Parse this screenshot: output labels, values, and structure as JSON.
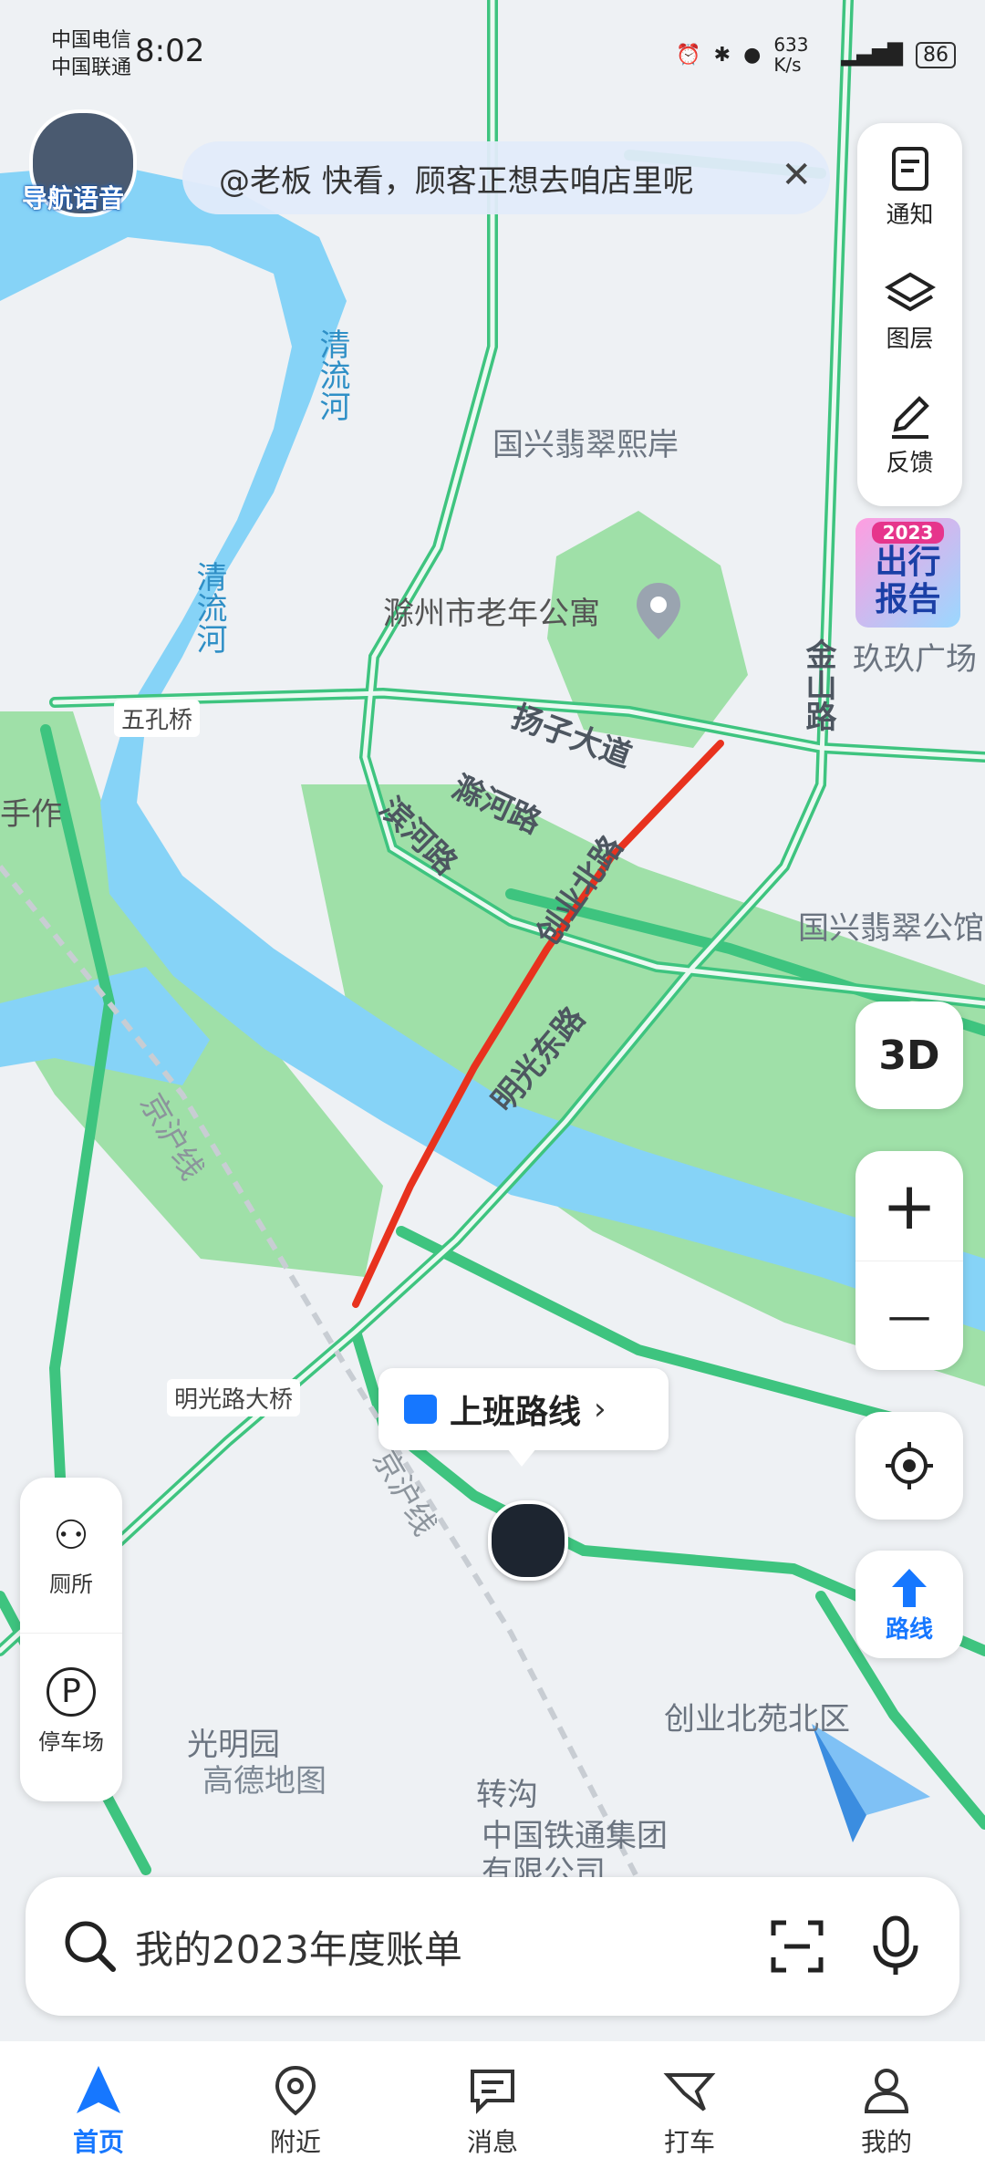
{
  "status_bar": {
    "carrier_1": "中国电信",
    "carrier_2": "中国联通",
    "time": "8:02",
    "net_speed": "633 K/s",
    "battery": "86"
  },
  "voice_badge": {
    "label": "导航语音"
  },
  "banner": {
    "text": "@老板 快看，顾客正想去咱店里呢"
  },
  "tools": {
    "notice": "通知",
    "layers": "图层",
    "feedback": "反馈"
  },
  "promo": {
    "year": "2023",
    "line1": "出行",
    "line2": "报告"
  },
  "map_labels": {
    "qingliu_he_1": "清流河",
    "qingliu_he_2": "清流河",
    "guoxing_feicui": "国兴翡翠熙岸",
    "laonian_gongyu": "滁州市老年公寓",
    "jinshan_lu": "金山路",
    "jiujiu_guangchang": "玖玖广场",
    "wukong_qiao": "五孔桥",
    "yangzi_dadao": "扬子大道",
    "chuhe_lu": "滁河路",
    "binhe_lu": "滨河路",
    "chuangye_bei_lu": "创业北路",
    "guoxing_gongguan": "国兴翡翠公馆",
    "shougongzuo": "手作",
    "mingguang_dong_lu": "明光东路",
    "jinghu_xian_1": "京沪线",
    "jinghu_xian_2": "京沪线",
    "mingguanglu_daqiao": "明光路大桥",
    "guangming_yuan": "光明园",
    "zhuangou": "转沟",
    "tietong": "中国铁通集团有限公司",
    "chuangye_beiyuan": "创业北苑北区",
    "gaode_watermark": "高德地图"
  },
  "commute": {
    "label": "上班路线"
  },
  "map_controls": {
    "three_d": "3D",
    "zoom_in": "+",
    "zoom_out": "—",
    "route": "路线"
  },
  "left_panel": {
    "toilet": "厕所",
    "parking": "停车场"
  },
  "search": {
    "placeholder": "我的2023年度账单"
  },
  "tabs": [
    {
      "label": "首页"
    },
    {
      "label": "附近"
    },
    {
      "label": "消息"
    },
    {
      "label": "打车"
    },
    {
      "label": "我的"
    }
  ],
  "colors": {
    "accent": "#1677ff",
    "route": "#e8321e",
    "road": "#3ec47f",
    "water": "#86d3f7",
    "park": "#9fe0a8"
  }
}
